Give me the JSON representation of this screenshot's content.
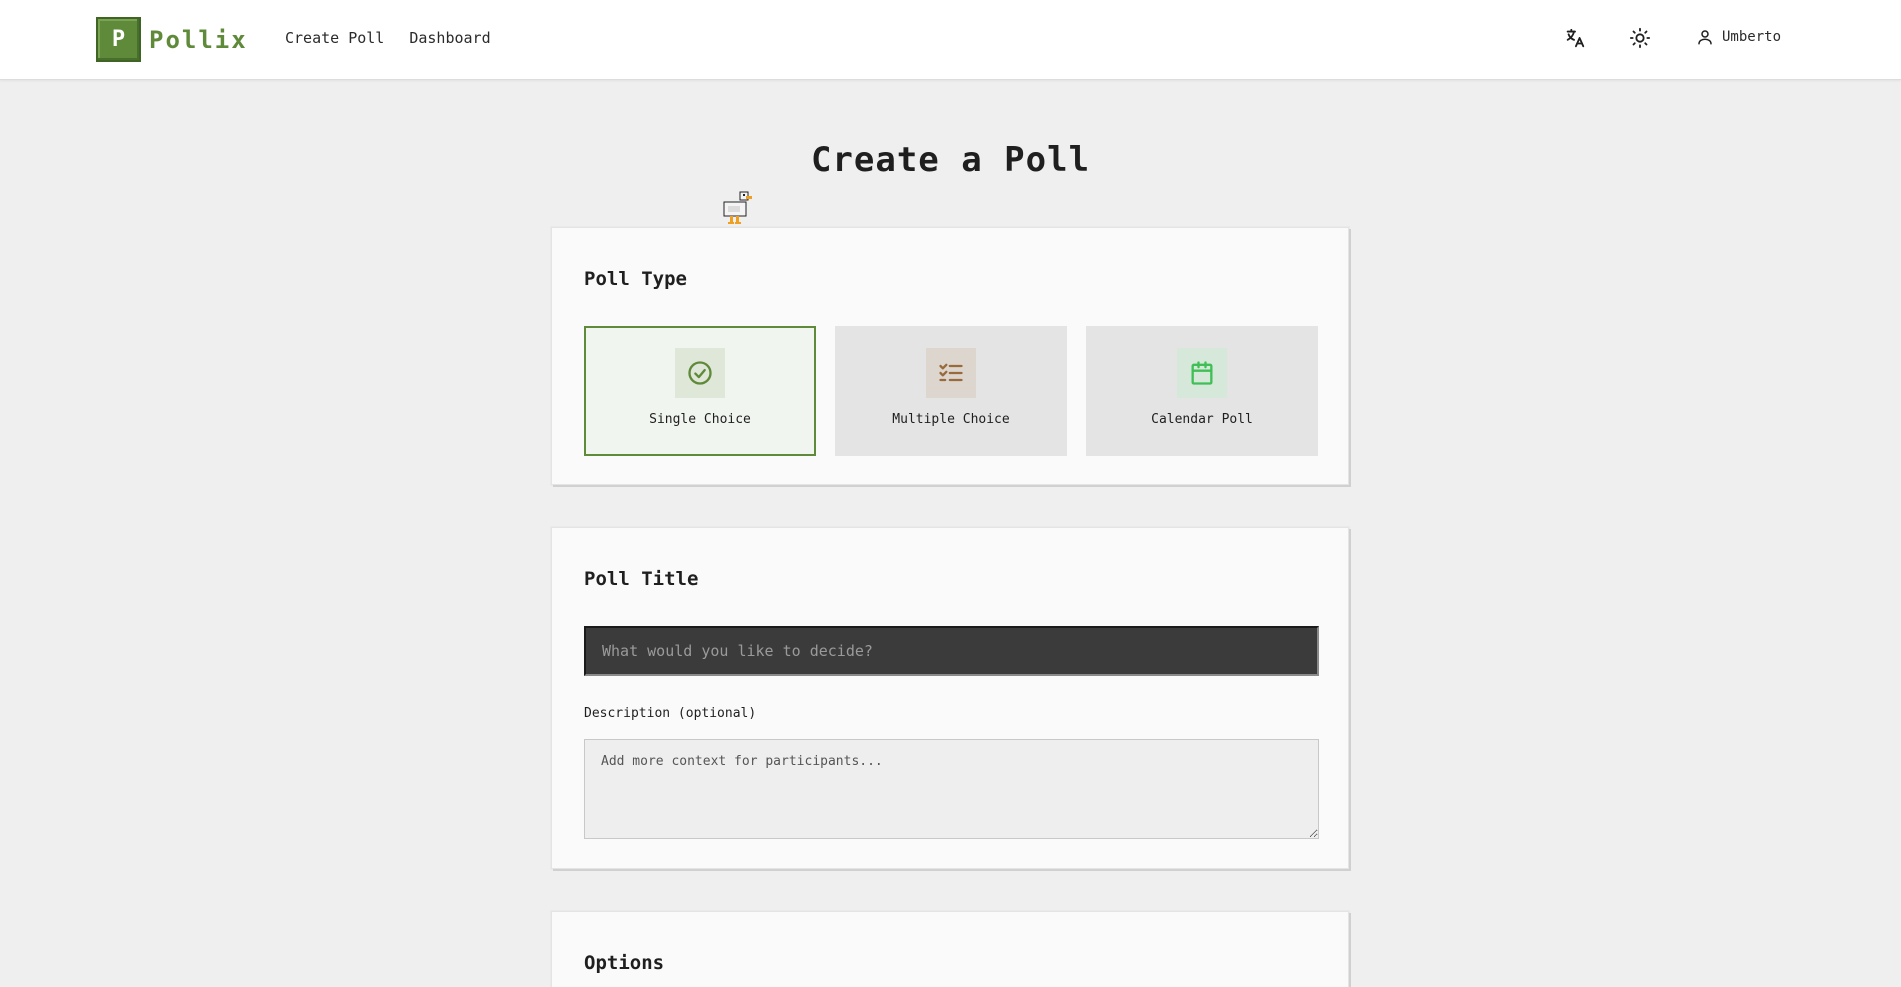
{
  "header": {
    "logo_letter": "P",
    "brand": "Pollix",
    "nav": [
      {
        "label": "Create Poll"
      },
      {
        "label": "Dashboard"
      }
    ],
    "icons": [
      "translate-icon",
      "sun-icon",
      "user-icon"
    ],
    "username": "Umberto"
  },
  "page": {
    "title": "Create a Poll"
  },
  "poll_type": {
    "title": "Poll Type",
    "options": [
      {
        "label": "Single Choice",
        "icon": "check-circle-icon",
        "selected": true,
        "color": "#5e8a3a"
      },
      {
        "label": "Multiple Choice",
        "icon": "list-check-icon",
        "selected": false,
        "color": "#9a6b3a"
      },
      {
        "label": "Calendar Poll",
        "icon": "calendar-icon",
        "selected": false,
        "color": "#3fbf55"
      }
    ]
  },
  "poll_title": {
    "title": "Poll Title",
    "placeholder": "What would you like to decide?",
    "value": "",
    "description_label": "Description (optional)",
    "description_placeholder": "Add more context for participants...",
    "description_value": ""
  },
  "options_section": {
    "title": "Options"
  },
  "colors": {
    "accent": "#5e8a3a",
    "background": "#efefef",
    "card": "#fafafa",
    "input_dark": "#3b3b3b"
  }
}
